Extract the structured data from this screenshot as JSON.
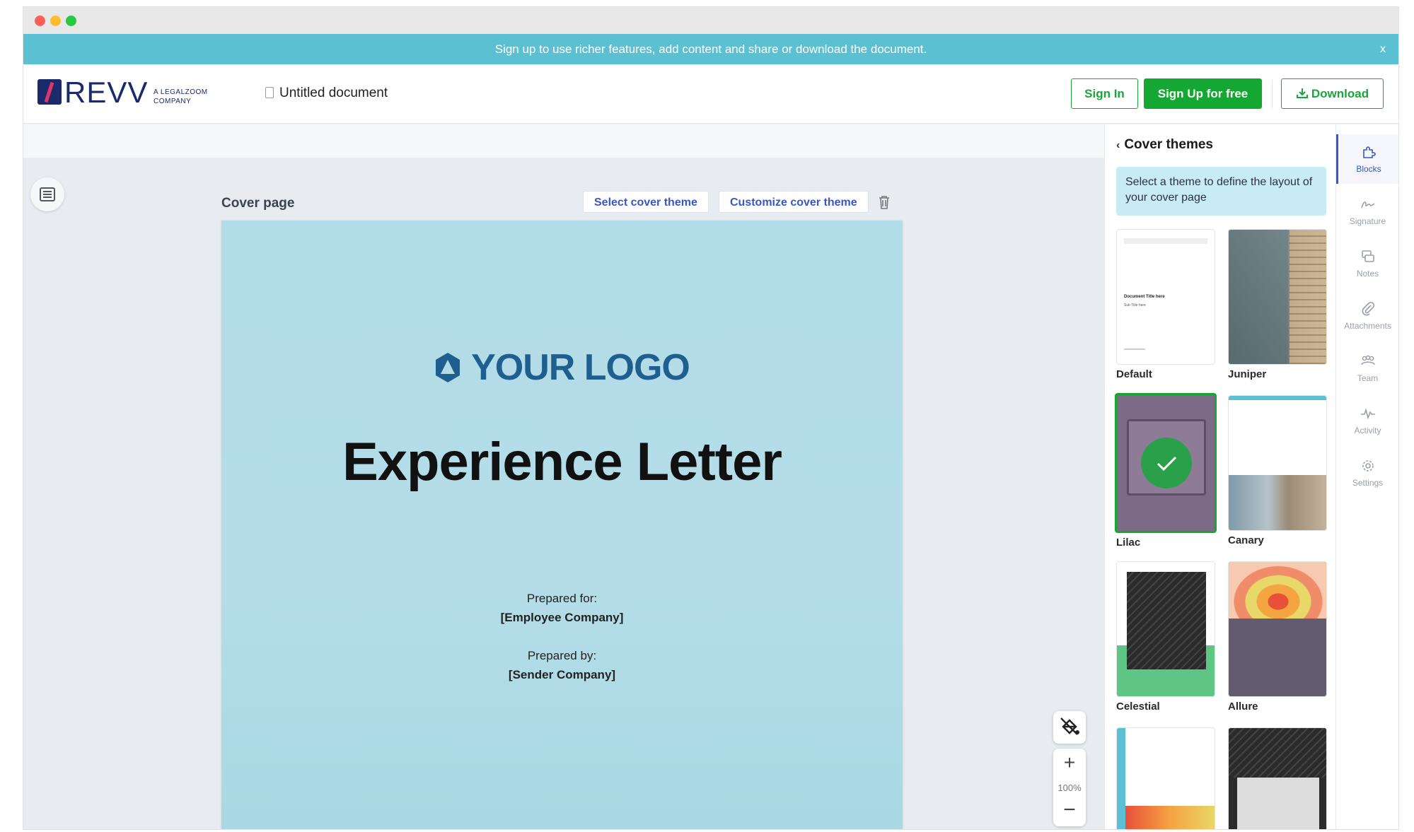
{
  "banner": {
    "text": "Sign up to use richer features, add content and share or download the document.",
    "close": "x"
  },
  "brand": {
    "name": "REVV",
    "tagline": "A LEGALZOOM COMPANY"
  },
  "document": {
    "name": "Untitled document"
  },
  "header": {
    "signin": "Sign In",
    "signup": "Sign Up for free",
    "download": "Download"
  },
  "editor": {
    "section_label": "Cover page",
    "select_theme": "Select cover theme",
    "customize_theme": "Customize cover theme",
    "zoom": "100%",
    "zoom_in": "+",
    "zoom_out": "−"
  },
  "cover": {
    "logo_text": "YOUR LOGO",
    "title": "Experience Letter",
    "prepared_for_label": "Prepared for:",
    "prepared_for_value": "[Employee Company]",
    "prepared_by_label": "Prepared by:",
    "prepared_by_value": "[Sender Company]"
  },
  "panel": {
    "title": "Cover themes",
    "info": "Select a theme to define the layout of your cover page",
    "themes": [
      {
        "name": "Default",
        "thumb_title": "Document Title here",
        "thumb_sub": "Sub Title here"
      },
      {
        "name": "Juniper"
      },
      {
        "name": "Lilac",
        "selected": true
      },
      {
        "name": "Canary"
      },
      {
        "name": "Celestial"
      },
      {
        "name": "Allure"
      }
    ]
  },
  "rail": [
    {
      "label": "Blocks",
      "active": true
    },
    {
      "label": "Signature"
    },
    {
      "label": "Notes"
    },
    {
      "label": "Attachments"
    },
    {
      "label": "Team"
    },
    {
      "label": "Activity"
    },
    {
      "label": "Settings"
    }
  ],
  "colors": {
    "accent_green": "#14a833",
    "accent_blue": "#3956c9",
    "banner": "#5bc1d2",
    "brand_navy": "#1b2a6b"
  }
}
